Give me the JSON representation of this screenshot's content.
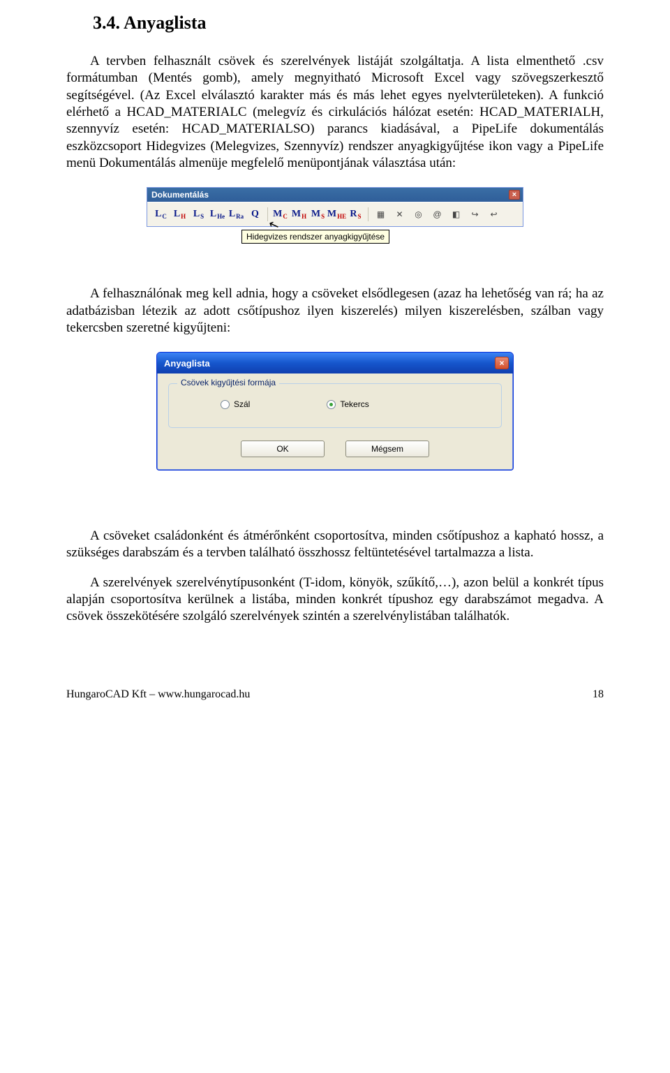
{
  "section": {
    "title": "3.4. Anyaglista"
  },
  "paragraphs": {
    "p1": "A tervben felhasznált csövek és szerelvények listáját szolgáltatja. A lista elmenthető .csv formátumban (Mentés gomb), amely megnyitható Microsoft Excel vagy szövegszerkesztő segítségével. (Az Excel elválasztó karakter más és más lehet egyes nyelvterületeken). A funkció elérhető a HCAD_MATERIALC (melegvíz és cirkulációs hálózat esetén: HCAD_MATERIALH, szennyvíz esetén: HCAD_MATERIALSO) parancs kiadásával, a PipeLife dokumentálás eszközcsoport Hidegvizes (Melegvizes, Szennyvíz) rendszer anyagkigyűjtése ikon vagy a PipeLife menü Dokumentálás almenüje megfelelő menüpontjának választása után:",
    "p2": "A felhasználónak meg kell adnia, hogy a csöveket elsődlegesen (azaz ha lehetőség van rá; ha az adatbázisban létezik az adott csőtípushoz ilyen kiszerelés) milyen kiszerelésben, szálban vagy tekercsben szeretné kigyűjteni:",
    "p3": "A csöveket családonként és átmérőnként csoportosítva, minden csőtípushoz a kapható hossz, a szükséges darabszám és a tervben található összhossz feltüntetésével tartalmazza a lista.",
    "p4": "A szerelvények szerelvénytípusonként (T-idom, könyök, szűkítő,…), azon belül a konkrét típus alapján csoportosítva kerülnek a listába, minden konkrét típushoz egy darabszámot megadva. A csövek összekötésére szolgáló szerelvények szintén a szerelvénylistában találhatók."
  },
  "toolbar": {
    "title": "Dokumentálás",
    "tooltip": "Hidegvizes rendszer anyagkigyűjtése",
    "buttons": [
      {
        "name": "lc",
        "main": "L",
        "sub": "C",
        "subColor": "blue"
      },
      {
        "name": "lh",
        "main": "L",
        "sub": "H",
        "subColor": "red"
      },
      {
        "name": "ls",
        "main": "L",
        "sub": "S",
        "subColor": "blue"
      },
      {
        "name": "lhe",
        "main": "L",
        "sub": "He",
        "subColor": "blue"
      },
      {
        "name": "lra",
        "main": "L",
        "sub": "Ra",
        "subColor": "blue"
      },
      {
        "name": "q",
        "main": "Q",
        "sub": "",
        "subColor": "blue"
      },
      {
        "name": "mc",
        "main": "M",
        "sub": "C",
        "subColor": "red"
      },
      {
        "name": "mh",
        "main": "M",
        "sub": "H",
        "subColor": "red"
      },
      {
        "name": "ms",
        "main": "M",
        "sub": "S",
        "subColor": "red"
      },
      {
        "name": "mhe",
        "main": "M",
        "sub": "HE",
        "subColor": "red"
      },
      {
        "name": "rs",
        "main": "R",
        "sub": "S",
        "subColor": "red"
      }
    ],
    "extras": [
      {
        "name": "grid-icon",
        "glyph": "▦"
      },
      {
        "name": "cross-icon",
        "glyph": "✕"
      },
      {
        "name": "circle-icon",
        "glyph": "◎"
      },
      {
        "name": "at-icon",
        "glyph": "@"
      },
      {
        "name": "corner-icon",
        "glyph": "◧"
      },
      {
        "name": "arrow-icon-1",
        "glyph": "↪"
      },
      {
        "name": "arrow-icon-2",
        "glyph": "↩"
      }
    ]
  },
  "dialog": {
    "title": "Anyaglista",
    "group_title": "Csövek kigyűjtési formája",
    "radio_szal": "Szál",
    "radio_tekercs": "Tekercs",
    "ok": "OK",
    "cancel": "Mégsem"
  },
  "footer": {
    "left": "HungaroCAD Kft – www.hungarocad.hu",
    "right": "18"
  }
}
